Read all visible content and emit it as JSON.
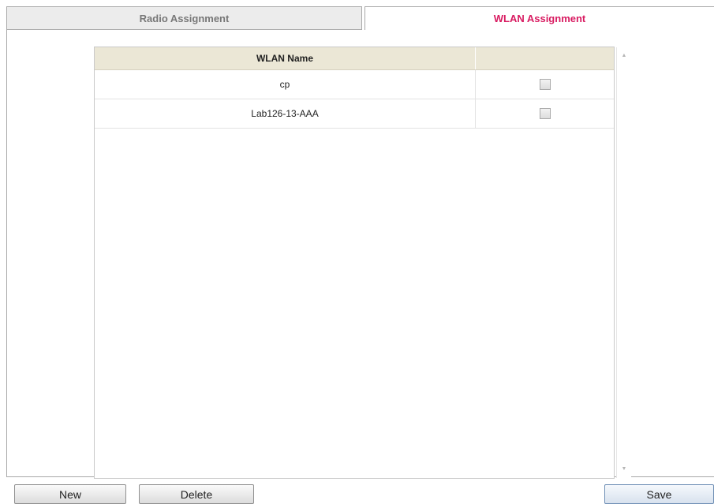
{
  "tabs": [
    {
      "label": "Radio Assignment",
      "active": false
    },
    {
      "label": "WLAN Assignment",
      "active": true
    }
  ],
  "grid": {
    "columns": [
      "WLAN Name",
      ""
    ],
    "rows": [
      {
        "name": "cp",
        "checked": false
      },
      {
        "name": "Lab126-13-AAA",
        "checked": false
      }
    ]
  },
  "buttons": {
    "new": "New",
    "delete": "Delete",
    "save": "Save"
  },
  "colors": {
    "active_tab_text": "#d81a60",
    "header_bg": "#ebe7d6"
  }
}
